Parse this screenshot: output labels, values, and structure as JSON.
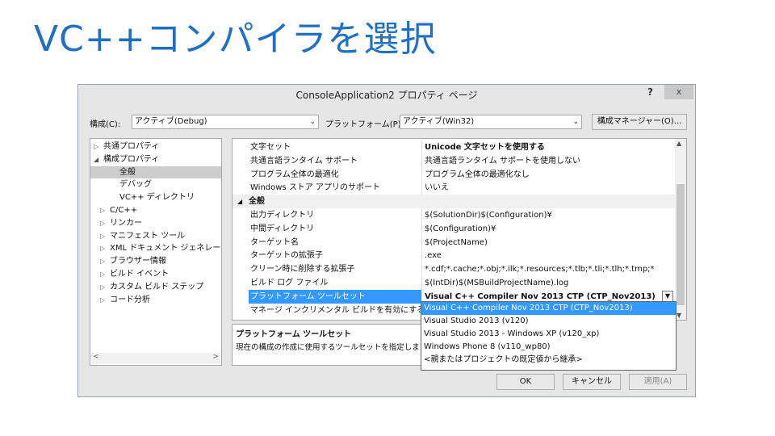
{
  "slide": {
    "title": "VC++コンパイラを選択"
  },
  "dialog": {
    "title": "ConsoleApplication2 プロパティ ページ",
    "help": "?",
    "close": "x",
    "config_label": "構成(C):",
    "config_value": "アクティブ(Debug)",
    "platform_label": "プラットフォーム(P):",
    "platform_value": "アクティブ(Win32)",
    "config_manager": "構成マネージャー(O)...",
    "ok": "OK",
    "cancel": "キャンセル",
    "apply": "適用(A)"
  },
  "tree": {
    "items": [
      {
        "label": "共通プロパティ",
        "expander": "▷"
      },
      {
        "label": "構成プロパティ",
        "expander": "◢"
      },
      {
        "label": "全般",
        "expander": ""
      },
      {
        "label": "デバッグ",
        "expander": ""
      },
      {
        "label": "VC++ ディレクトリ",
        "expander": ""
      },
      {
        "label": "C/C++",
        "expander": "▷"
      },
      {
        "label": "リンカー",
        "expander": "▷"
      },
      {
        "label": "マニフェスト ツール",
        "expander": "▷"
      },
      {
        "label": "XML ドキュメント ジェネレーター",
        "expander": "▷"
      },
      {
        "label": "ブラウザー情報",
        "expander": "▷"
      },
      {
        "label": "ビルド イベント",
        "expander": "▷"
      },
      {
        "label": "カスタム ビルド ステップ",
        "expander": "▷"
      },
      {
        "label": "コード分析",
        "expander": "▷"
      }
    ],
    "scroll_left": "<",
    "scroll_right": ">"
  },
  "grid": {
    "rows": [
      {
        "name": "文字セット",
        "value": "Unicode 文字セットを使用する"
      },
      {
        "name": "共通言語ランタイム サポート",
        "value": "共通言語ランタイム サポートを使用しない"
      },
      {
        "name": "プログラム全体の最適化",
        "value": "プログラム全体の最適化なし"
      },
      {
        "name": "Windows ストア アプリのサポート",
        "value": "いいえ"
      },
      {
        "name": "全般",
        "value": "",
        "expander": "◢"
      },
      {
        "name": "出力ディレクトリ",
        "value": "$(SolutionDir)$(Configuration)¥"
      },
      {
        "name": "中間ディレクトリ",
        "value": "$(Configuration)¥"
      },
      {
        "name": "ターゲット名",
        "value": "$(ProjectName)"
      },
      {
        "name": "ターゲットの拡張子",
        "value": ".exe"
      },
      {
        "name": "クリーン時に削除する拡張子",
        "value": "*.cdf;*.cache;*.obj;*.ilk;*.resources;*.tlb;*.tli;*.tlh;*.tmp;*"
      },
      {
        "name": "ビルド ログ ファイル",
        "value": "$(IntDir)$(MSBuildProjectName).log"
      },
      {
        "name": "プラットフォーム ツールセット",
        "value": "Visual C++ Compiler Nov 2013 CTP (CTP_Nov2013)"
      },
      {
        "name": "マネージ インクリメンタル ビルドを有効にする",
        "value": ""
      }
    ],
    "scroll_up": "▲",
    "scroll_down": "▼",
    "dropdown_arrow": "▼"
  },
  "description": {
    "heading": "プラットフォーム ツールセット",
    "body": "現在の構成の作成に使用するツールセットを指定します。"
  },
  "dropdown": {
    "options": [
      "Visual C++ Compiler Nov 2013 CTP (CTP_Nov2013)",
      "Visual Studio 2013 (v120)",
      "Visual Studio 2013 - Windows XP (v120_xp)",
      "Windows Phone 8 (v110_wp80)",
      "<親またはプロジェクトの既定値から継承>"
    ]
  }
}
